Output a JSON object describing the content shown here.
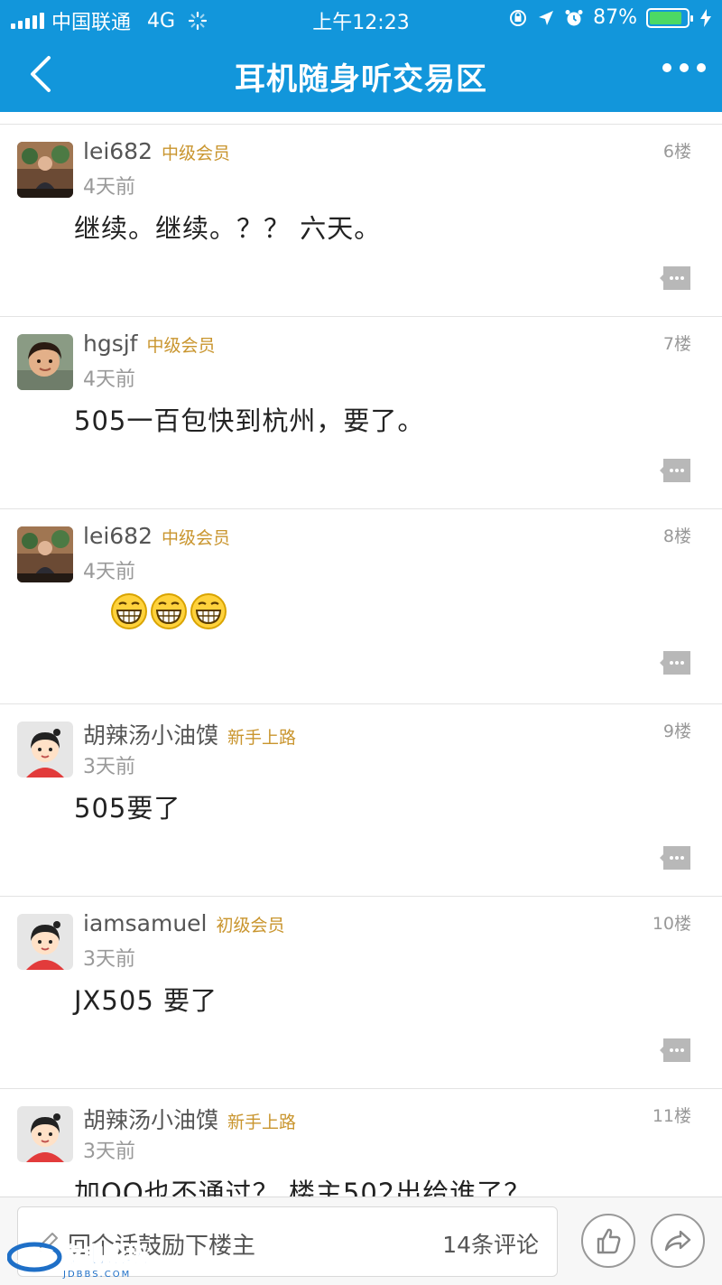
{
  "status_bar": {
    "carrier": "中国联通",
    "network": "4G",
    "time": "上午12:23",
    "battery_percent": "87%",
    "battery_level": 0.87
  },
  "nav": {
    "title": "耳机随身听交易区"
  },
  "posts": [
    {
      "username": "lei682",
      "badge": "中级会员",
      "time": "4天前",
      "floor": "6楼",
      "content": "继续。继续。？？ 六天。"
    },
    {
      "username": "hgsjf",
      "badge": "中级会员",
      "time": "4天前",
      "floor": "7楼",
      "content": "505一百包快到杭州，要了。"
    },
    {
      "username": "lei682",
      "badge": "中级会员",
      "time": "4天前",
      "floor": "8楼",
      "content": "",
      "emoji_icon": "grin-emoji-icon",
      "emoji_count": 3
    },
    {
      "username": "胡辣汤小油馍",
      "badge": "新手上路",
      "time": "3天前",
      "floor": "9楼",
      "content": "505要了"
    },
    {
      "username": "iamsamuel",
      "badge": "初级会员",
      "time": "3天前",
      "floor": "10楼",
      "content": "JX505 要了"
    },
    {
      "username": "胡辣汤小油馍",
      "badge": "新手上路",
      "time": "3天前",
      "floor": "11楼",
      "content": "加QQ也不通过？ 楼主502出给谁了？"
    }
  ],
  "bottom_bar": {
    "placeholder": "回个话鼓励下楼主",
    "comment_count": "14条评论"
  },
  "watermark": {
    "brand": "家电论坛",
    "site": "JDBBS.COM"
  },
  "colors": {
    "header": "#1296db",
    "badge": "#c9952e",
    "battery": "#4cd964"
  }
}
